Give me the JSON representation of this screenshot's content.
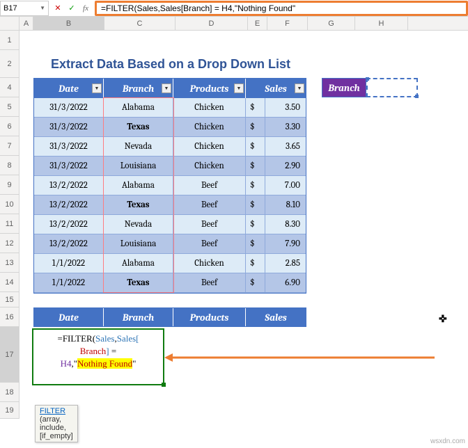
{
  "formula_bar": {
    "name_box": "B17",
    "formula": "=FILTER(Sales,Sales[Branch] = H4,\"Nothing Found\""
  },
  "columns": [
    "A",
    "B",
    "C",
    "D",
    "E",
    "F",
    "G",
    "H"
  ],
  "rows": [
    "1",
    "2",
    "3",
    "4",
    "5",
    "6",
    "7",
    "8",
    "9",
    "10",
    "11",
    "12",
    "13",
    "14",
    "15",
    "16",
    "17",
    "18",
    "19"
  ],
  "title": "Extract Data Based on a Drop Down List",
  "headers": {
    "date": "Date",
    "branch": "Branch",
    "products": "Products",
    "sales": "Sales"
  },
  "data": [
    {
      "date": "31/3/2022",
      "branch": "Alabama",
      "products": "Chicken",
      "curr": "$",
      "val": "3.50",
      "bold": false
    },
    {
      "date": "31/3/2022",
      "branch": "Texas",
      "products": "Chicken",
      "curr": "$",
      "val": "3.30",
      "bold": true
    },
    {
      "date": "31/3/2022",
      "branch": "Nevada",
      "products": "Chicken",
      "curr": "$",
      "val": "3.65",
      "bold": false
    },
    {
      "date": "31/3/2022",
      "branch": "Louisiana",
      "products": "Chicken",
      "curr": "$",
      "val": "2.90",
      "bold": false
    },
    {
      "date": "13/2/2022",
      "branch": "Alabama",
      "products": "Beef",
      "curr": "$",
      "val": "7.00",
      "bold": false
    },
    {
      "date": "13/2/2022",
      "branch": "Texas",
      "products": "Beef",
      "curr": "$",
      "val": "8.10",
      "bold": true
    },
    {
      "date": "13/2/2022",
      "branch": "Nevada",
      "products": "Beef",
      "curr": "$",
      "val": "8.30",
      "bold": false
    },
    {
      "date": "13/2/2022",
      "branch": "Louisiana",
      "products": "Beef",
      "curr": "$",
      "val": "7.90",
      "bold": false
    },
    {
      "date": "1/1/2022",
      "branch": "Alabama",
      "products": "Chicken",
      "curr": "$",
      "val": "2.85",
      "bold": false
    },
    {
      "date": "1/1/2022",
      "branch": "Texas",
      "products": "Beef",
      "curr": "$",
      "val": "6.90",
      "bold": true
    }
  ],
  "side": {
    "label": "Branch"
  },
  "cell_formula": {
    "eq": "=",
    "fn": "FILTER(",
    "tbl1": "Sales",
    "c1": ",",
    "tbl2": "Sales[",
    "br": "Branch",
    "tbl3": "]",
    "eq2": " = ",
    "h4": "H4",
    "c2": ",",
    "q1": "\"",
    "str": "Nothing Found",
    "q2": "\""
  },
  "tooltip": {
    "fn": "FILTER",
    "sig": " (array, include, [if_empty]"
  },
  "watermark": "wsxdn.com",
  "cursor_glyph": "✜"
}
